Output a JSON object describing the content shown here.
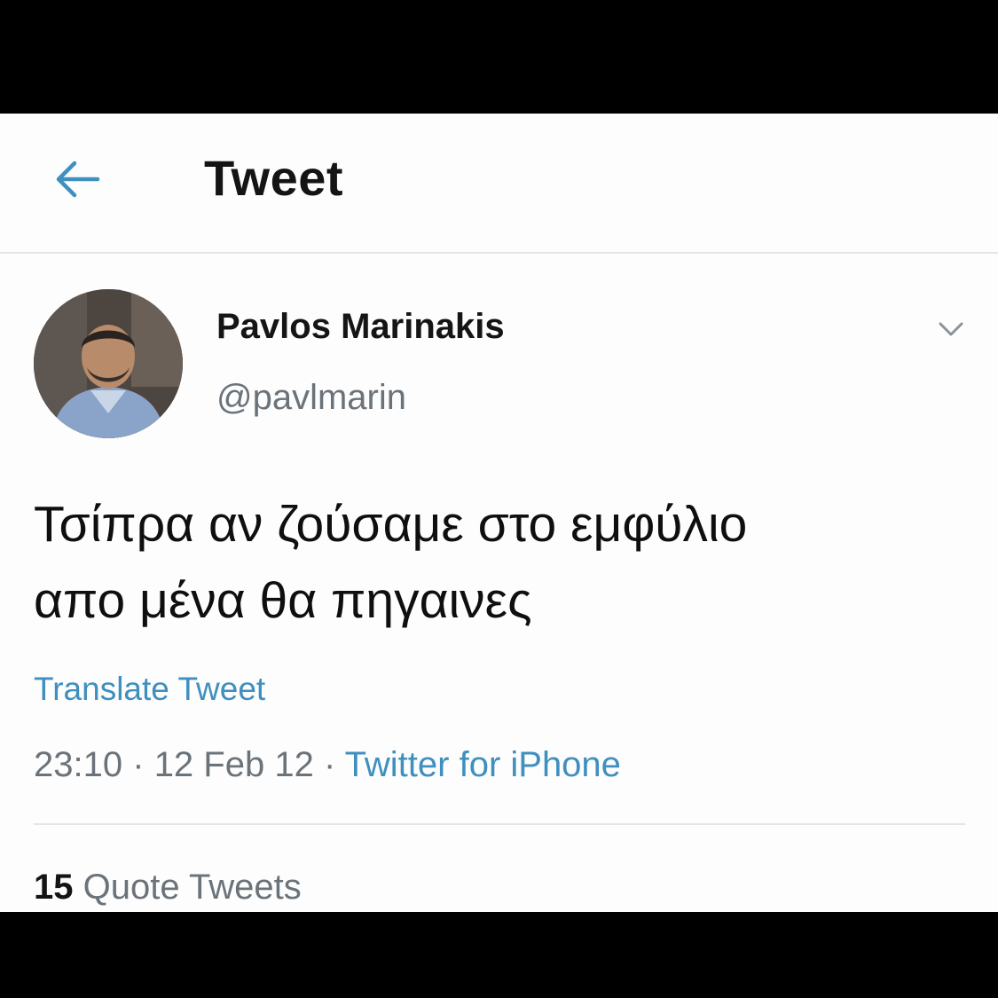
{
  "header": {
    "title": "Tweet",
    "back_icon": "arrow-left-icon",
    "accent_color": "#3f8fbf"
  },
  "tweet": {
    "display_name": "Pavlos Marinakis",
    "handle": "@pavlmarin",
    "menu_icon": "chevron-down-icon",
    "text": "Τσίπρα αν ζούσαμε στο εμφύλιο\nαπο μένα θα πηγαινες",
    "translate_label": "Translate Tweet",
    "time": "23:10",
    "date": "12 Feb 12",
    "separator": "·",
    "source": "Twitter for iPhone"
  },
  "stats": {
    "quote_count": "15",
    "quote_label": "Quote Tweets"
  }
}
